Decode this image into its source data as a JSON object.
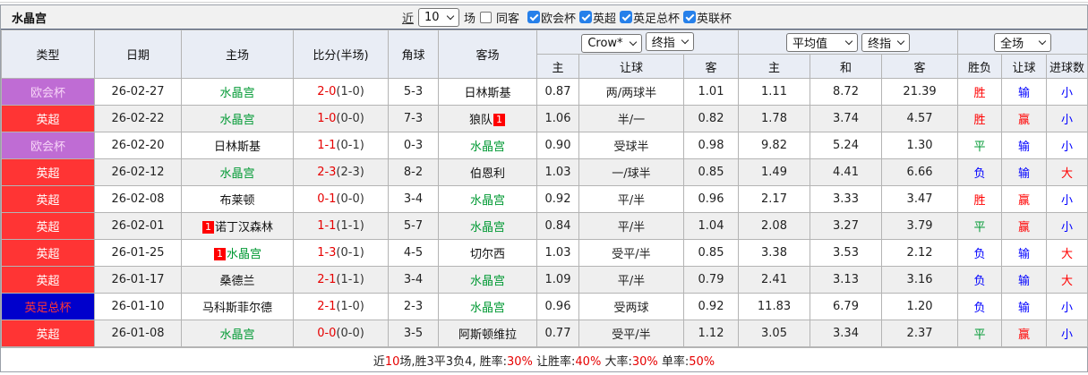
{
  "title": "水晶宫",
  "colors": {
    "type_purple_bg": "#bf6cd4",
    "type_purple_text": "#f7d4f7",
    "type_red_bg": "#ff3434",
    "type_red_text": "#ffffff",
    "type_blue_bg": "#0000cc",
    "type_blue_text": "#ff3434",
    "team_self": "#009933",
    "score_red": "#e60000",
    "result_red": "#ff0000",
    "result_blue": "#0000ff",
    "result_green": "#009933",
    "header_bg": "#e9edf5",
    "odds_col_bg": "#fdf5ed",
    "avg_col_bg": "#e3f1f9"
  },
  "controls": {
    "recent_label": "近",
    "recent_value": "10",
    "matches_label": "场",
    "same_venue_label": "同客",
    "same_venue_checked": false,
    "filters": [
      {
        "label": "欧会杯",
        "checked": true
      },
      {
        "label": "英超",
        "checked": true
      },
      {
        "label": "英足总杯",
        "checked": true
      },
      {
        "label": "英联杯",
        "checked": true
      }
    ]
  },
  "header": {
    "col_type": "类型",
    "col_date": "日期",
    "col_home": "主场",
    "col_score": "比分(半场)",
    "col_corner": "角球",
    "col_away": "客场",
    "odds_source_select": "Crow*",
    "odds_stage_select": "终指",
    "avg_source_select": "平均值",
    "avg_stage_select": "终指",
    "scope_select": "全场",
    "sub": [
      "主",
      "让球",
      "客",
      "主",
      "和",
      "客",
      "胜负",
      "让球",
      "进球数"
    ]
  },
  "rows": [
    {
      "type": {
        "label": "欧会杯",
        "style": "purple"
      },
      "date": "26-02-27",
      "home": {
        "name": "水晶宫",
        "self": true
      },
      "score": {
        "full": "2-0",
        "half": "(1-0)"
      },
      "corner": "5-3",
      "away": {
        "name": "日林斯基",
        "self": false
      },
      "odds": [
        "0.87",
        "两/两球半",
        "1.01"
      ],
      "avg": [
        "1.11",
        "8.72",
        "21.39"
      ],
      "res": [
        "胜",
        "输",
        "小"
      ]
    },
    {
      "type": {
        "label": "英超",
        "style": "red"
      },
      "date": "26-02-22",
      "home": {
        "name": "水晶宫",
        "self": true
      },
      "score": {
        "full": "1-0",
        "half": "(0-0)"
      },
      "corner": "7-3",
      "away": {
        "name": "狼队",
        "self": false,
        "badge": "1",
        "badge_pos": "after"
      },
      "odds": [
        "1.06",
        "半/一",
        "0.82"
      ],
      "avg": [
        "1.78",
        "3.74",
        "4.57"
      ],
      "res": [
        "胜",
        "赢",
        "小"
      ]
    },
    {
      "type": {
        "label": "欧会杯",
        "style": "purple"
      },
      "date": "26-02-20",
      "home": {
        "name": "日林斯基",
        "self": false
      },
      "score": {
        "full": "1-1",
        "half": "(0-1)"
      },
      "corner": "0-3",
      "away": {
        "name": "水晶宫",
        "self": true
      },
      "odds": [
        "0.90",
        "受球半",
        "0.98"
      ],
      "avg": [
        "9.82",
        "5.24",
        "1.30"
      ],
      "res": [
        "平",
        "输",
        "小"
      ]
    },
    {
      "type": {
        "label": "英超",
        "style": "red"
      },
      "date": "26-02-12",
      "home": {
        "name": "水晶宫",
        "self": true
      },
      "score": {
        "full": "2-3",
        "half": "(2-3)"
      },
      "corner": "8-2",
      "away": {
        "name": "伯恩利",
        "self": false
      },
      "odds": [
        "1.03",
        "一/球半",
        "0.85"
      ],
      "avg": [
        "1.49",
        "4.41",
        "6.66"
      ],
      "res": [
        "负",
        "输",
        "大"
      ]
    },
    {
      "type": {
        "label": "英超",
        "style": "red"
      },
      "date": "26-02-08",
      "home": {
        "name": "布莱顿",
        "self": false
      },
      "score": {
        "full": "0-1",
        "half": "(0-0)"
      },
      "corner": "3-4",
      "away": {
        "name": "水晶宫",
        "self": true
      },
      "odds": [
        "0.92",
        "平/半",
        "0.96"
      ],
      "avg": [
        "2.17",
        "3.33",
        "3.47"
      ],
      "res": [
        "胜",
        "赢",
        "小"
      ]
    },
    {
      "type": {
        "label": "英超",
        "style": "red"
      },
      "date": "26-02-01",
      "home": {
        "name": "诺丁汉森林",
        "self": false,
        "badge": "1",
        "badge_pos": "before"
      },
      "score": {
        "full": "1-1",
        "half": "(1-1)"
      },
      "corner": "5-7",
      "away": {
        "name": "水晶宫",
        "self": true
      },
      "odds": [
        "0.84",
        "平/半",
        "1.04"
      ],
      "avg": [
        "2.08",
        "3.27",
        "3.79"
      ],
      "res": [
        "平",
        "赢",
        "小"
      ]
    },
    {
      "type": {
        "label": "英超",
        "style": "red"
      },
      "date": "26-01-25",
      "home": {
        "name": "水晶宫",
        "self": true,
        "badge": "1",
        "badge_pos": "before"
      },
      "score": {
        "full": "1-3",
        "half": "(0-1)"
      },
      "corner": "4-5",
      "away": {
        "name": "切尔西",
        "self": false
      },
      "odds": [
        "1.03",
        "受平/半",
        "0.85"
      ],
      "avg": [
        "3.38",
        "3.53",
        "2.12"
      ],
      "res": [
        "负",
        "输",
        "大"
      ]
    },
    {
      "type": {
        "label": "英超",
        "style": "red"
      },
      "date": "26-01-17",
      "home": {
        "name": "桑德兰",
        "self": false
      },
      "score": {
        "full": "2-1",
        "half": "(1-1)"
      },
      "corner": "3-4",
      "away": {
        "name": "水晶宫",
        "self": true
      },
      "odds": [
        "1.09",
        "平/半",
        "0.79"
      ],
      "avg": [
        "2.41",
        "3.13",
        "3.16"
      ],
      "res": [
        "负",
        "输",
        "大"
      ]
    },
    {
      "type": {
        "label": "英足总杯",
        "style": "blue"
      },
      "date": "26-01-10",
      "home": {
        "name": "马科斯菲尔德",
        "self": false
      },
      "score": {
        "full": "2-1",
        "half": "(1-0)"
      },
      "corner": "2-3",
      "away": {
        "name": "水晶宫",
        "self": true
      },
      "odds": [
        "0.96",
        "受两球",
        "0.92"
      ],
      "avg": [
        "11.83",
        "6.79",
        "1.20"
      ],
      "res": [
        "负",
        "输",
        "小"
      ]
    },
    {
      "type": {
        "label": "英超",
        "style": "red"
      },
      "date": "26-01-08",
      "home": {
        "name": "水晶宫",
        "self": true
      },
      "score": {
        "full": "0-0",
        "half": "(0-0)"
      },
      "corner": "3-5",
      "away": {
        "name": "阿斯顿维拉",
        "self": false
      },
      "odds": [
        "0.77",
        "受平/半",
        "1.12"
      ],
      "avg": [
        "3.05",
        "3.34",
        "2.37"
      ],
      "res": [
        "平",
        "赢",
        "小"
      ]
    }
  ],
  "footer_segments": [
    {
      "text": "近",
      "red": false
    },
    {
      "text": "10",
      "red": true
    },
    {
      "text": "场,胜3平3负4, 胜率:",
      "red": false
    },
    {
      "text": "30%",
      "red": true
    },
    {
      "text": " 让胜率:",
      "red": false
    },
    {
      "text": "40%",
      "red": true
    },
    {
      "text": " 大率:",
      "red": false
    },
    {
      "text": "30%",
      "red": true
    },
    {
      "text": " 单率:",
      "red": false
    },
    {
      "text": "50%",
      "red": true
    }
  ]
}
